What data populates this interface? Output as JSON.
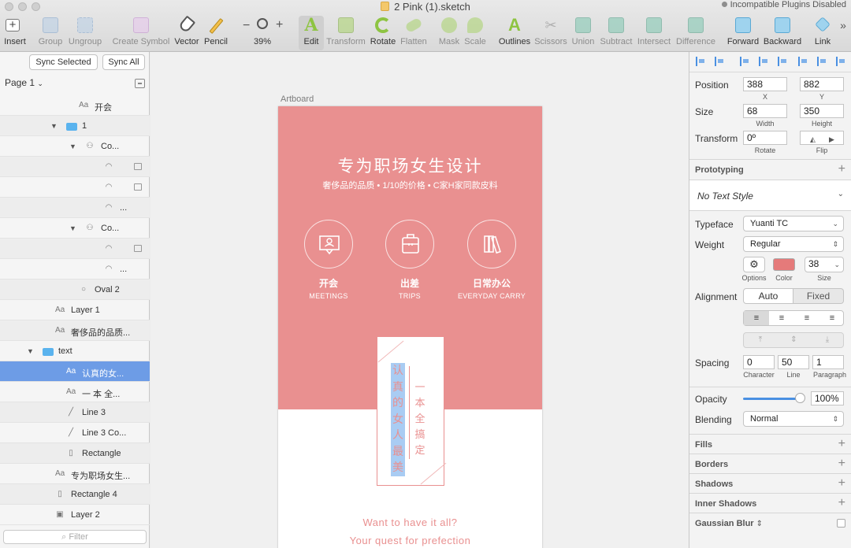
{
  "window": {
    "title": "2 Pink (1).sketch",
    "plugin_badge": "Incompatible Plugins Disabled"
  },
  "toolbar": {
    "items": [
      {
        "label": "Insert",
        "icon": "plus-icon"
      },
      {
        "label": "Group",
        "icon": "group-icon"
      },
      {
        "label": "Ungroup",
        "icon": "ungroup-icon"
      },
      {
        "label": "Create Symbol",
        "icon": "symbol-icon"
      },
      {
        "label": "Vector",
        "icon": "pen-icon"
      },
      {
        "label": "Pencil",
        "icon": "pencil-icon"
      },
      {
        "label": "39%",
        "icon": "zoom-icon"
      },
      {
        "label": "Edit",
        "icon": "edit-icon"
      },
      {
        "label": "Transform",
        "icon": "transform-icon"
      },
      {
        "label": "Rotate",
        "icon": "rotate-icon"
      },
      {
        "label": "Flatten",
        "icon": "flatten-icon"
      },
      {
        "label": "Mask",
        "icon": "mask-icon"
      },
      {
        "label": "Scale",
        "icon": "scale-icon"
      },
      {
        "label": "Outlines",
        "icon": "outlines-icon"
      },
      {
        "label": "Scissors",
        "icon": "scissors-icon"
      },
      {
        "label": "Union",
        "icon": "union-icon"
      },
      {
        "label": "Subtract",
        "icon": "subtract-icon"
      },
      {
        "label": "Intersect",
        "icon": "intersect-icon"
      },
      {
        "label": "Difference",
        "icon": "difference-icon"
      },
      {
        "label": "Forward",
        "icon": "forward-icon"
      },
      {
        "label": "Backward",
        "icon": "backward-icon"
      },
      {
        "label": "Link",
        "icon": "link-icon"
      }
    ],
    "zoom_minus": "−",
    "zoom_plus": "+",
    "more": "»"
  },
  "left_panel": {
    "sync_selected": "Sync Selected",
    "sync_all": "Sync All",
    "page": "Page 1",
    "layers": [
      {
        "name": "开会",
        "icon": "Aa"
      },
      {
        "name": "1",
        "icon": "folder"
      },
      {
        "name": "Co...",
        "icon": "symbol"
      },
      {
        "name": "",
        "icon": "shape"
      },
      {
        "name": "",
        "icon": "shape"
      },
      {
        "name": "...",
        "icon": "shape"
      },
      {
        "name": "Co...",
        "icon": "symbol"
      },
      {
        "name": "",
        "icon": "shape"
      },
      {
        "name": "...",
        "icon": "shape"
      },
      {
        "name": "Oval 2",
        "icon": "oval"
      },
      {
        "name": "Layer 1",
        "icon": "Aa"
      },
      {
        "name": "奢侈品的品质...",
        "icon": "Aa"
      },
      {
        "name": "text",
        "icon": "folder"
      },
      {
        "name": "认真的女...",
        "icon": "Aa"
      },
      {
        "name": "一 本 全...",
        "icon": "Aa"
      },
      {
        "name": "Line 3",
        "icon": "line"
      },
      {
        "name": "Line 3 Co...",
        "icon": "line"
      },
      {
        "name": "Rectangle",
        "icon": "rect"
      },
      {
        "name": "专为职场女生...",
        "icon": "Aa"
      },
      {
        "name": "Rectangle 4",
        "icon": "rect"
      },
      {
        "name": "Layer 2",
        "icon": "image"
      }
    ],
    "filter_placeholder": "Filter"
  },
  "canvas": {
    "artboard_label": "Artboard",
    "title": "专为职场女生设计",
    "subtitle": "奢侈品的品质 • 1/10的价格  •  C家H家同款皮料",
    "categories": [
      {
        "cn": "开会",
        "en": "MEETINGS",
        "icon": "meeting-icon"
      },
      {
        "cn": "出差",
        "en": "TRIPS",
        "icon": "luggage-icon"
      },
      {
        "cn": "日常办公",
        "en": "EVERYDAY CARRY",
        "icon": "books-icon"
      }
    ],
    "vertical_text_1": "认真的女人最美",
    "vertical_text_2": "一本全搞定",
    "tagline_1": "Want to have it all?",
    "tagline_2": "Your quest for prefection"
  },
  "inspector": {
    "position": {
      "label": "Position",
      "x": "388",
      "y": "882",
      "x_label": "X",
      "y_label": "Y"
    },
    "size": {
      "label": "Size",
      "width": "68",
      "height": "350",
      "width_label": "Width",
      "height_label": "Height"
    },
    "transform": {
      "label": "Transform",
      "rotate": "0º",
      "rotate_label": "Rotate",
      "flip_label": "Flip"
    },
    "prototyping": "Prototyping",
    "text_style": "No Text Style",
    "typeface": {
      "label": "Typeface",
      "value": "Yuanti TC"
    },
    "weight": {
      "label": "Weight",
      "value": "Regular"
    },
    "options_label": "Options",
    "color_label": "Color",
    "size_label": "Size",
    "font_size": "38",
    "alignment": {
      "label": "Alignment",
      "auto": "Auto",
      "fixed": "Fixed"
    },
    "spacing": {
      "label": "Spacing",
      "character": "0",
      "line": "50",
      "paragraph": "1",
      "character_label": "Character",
      "line_label": "Line",
      "paragraph_label": "Paragraph"
    },
    "opacity": {
      "label": "Opacity",
      "value": "100%"
    },
    "blending": {
      "label": "Blending",
      "value": "Normal"
    },
    "sections": [
      "Fills",
      "Borders",
      "Shadows",
      "Inner Shadows",
      "Gaussian Blur"
    ]
  },
  "colors": {
    "pink": "#e99090",
    "selection": "#6d9ce6",
    "text_highlight": "#a9ccf3"
  }
}
